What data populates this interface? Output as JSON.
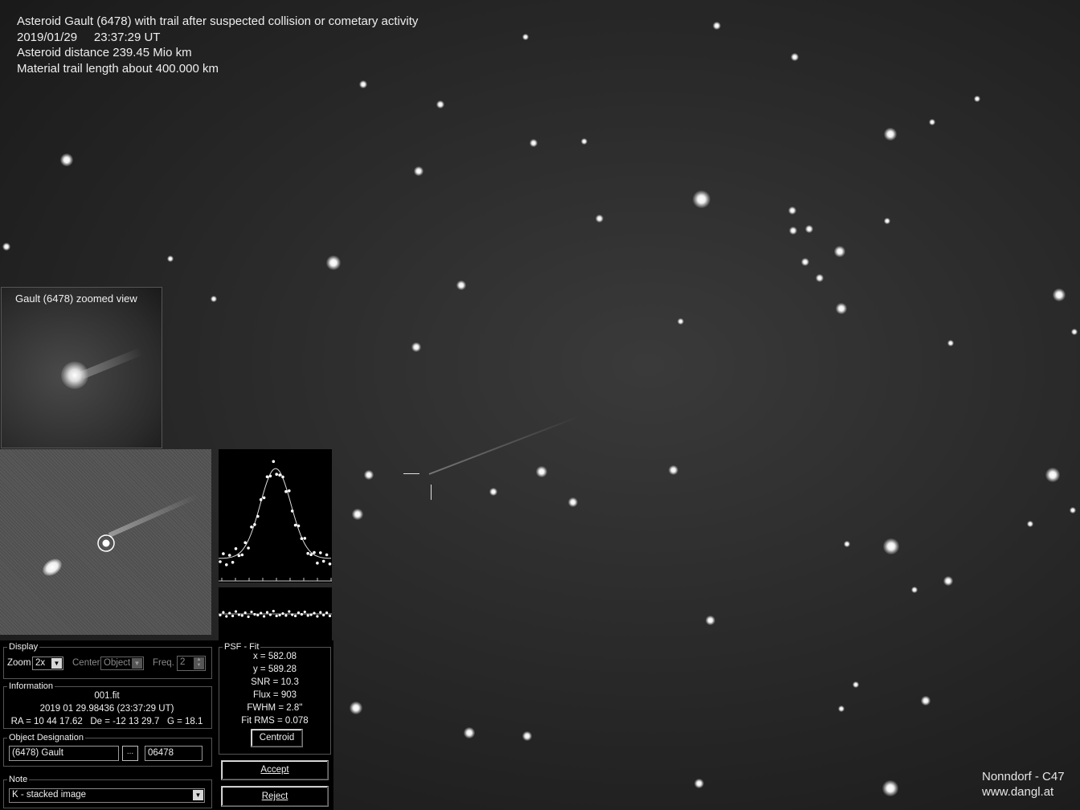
{
  "caption": {
    "line1": "Asteroid Gault (6478) with trail after suspected collision or cometary activity",
    "line2": "2019/01/29     23:37:29 UT",
    "line3": "Asteroid distance 239.45 Mio km",
    "line4": "Material trail length about 400.000 km"
  },
  "credit": {
    "line1": "Nonndorf - C47",
    "line2": "www.dangl.at"
  },
  "zoom_view": {
    "title": "Gault (6478) zoomed view"
  },
  "display": {
    "legend": "Display",
    "zoom_label": "Zoom",
    "zoom_value": "2x",
    "center_label": "Center",
    "center_value": "Object",
    "freq_label": "Freq.",
    "freq_value": "2"
  },
  "information": {
    "legend": "Information",
    "file": "001.fit",
    "date": "2019 01 29.98436 (23:37:29 UT)",
    "coords": "RA = 10 44 17.62   De = -12 13 29.7   G = 18.1"
  },
  "designation": {
    "legend": "Object Designation",
    "name": "(6478) Gault",
    "number": "06478",
    "browse_label": "..."
  },
  "note": {
    "legend": "Note",
    "value": "K - stacked image"
  },
  "psf_fit": {
    "legend": "PSF - Fit",
    "x": "x = 582.08",
    "y": "y = 589.28",
    "snr": "SNR = 10.3",
    "flux": "Flux = 903",
    "fwhm": "FWHM = 2.8''",
    "rms": "Fit RMS = 0.078",
    "centroid_label": "Centroid"
  },
  "buttons": {
    "accept": "Accept",
    "reject": "Reject"
  },
  "icons": {
    "dropdown": "chevron-down-icon",
    "spin": "spin-updown-icon",
    "browse": "ellipsis-icon",
    "target": "target-circle-icon"
  },
  "colors": {
    "sky": "#2a2a2a",
    "text": "#e8e8e8",
    "panel": "#000000"
  }
}
